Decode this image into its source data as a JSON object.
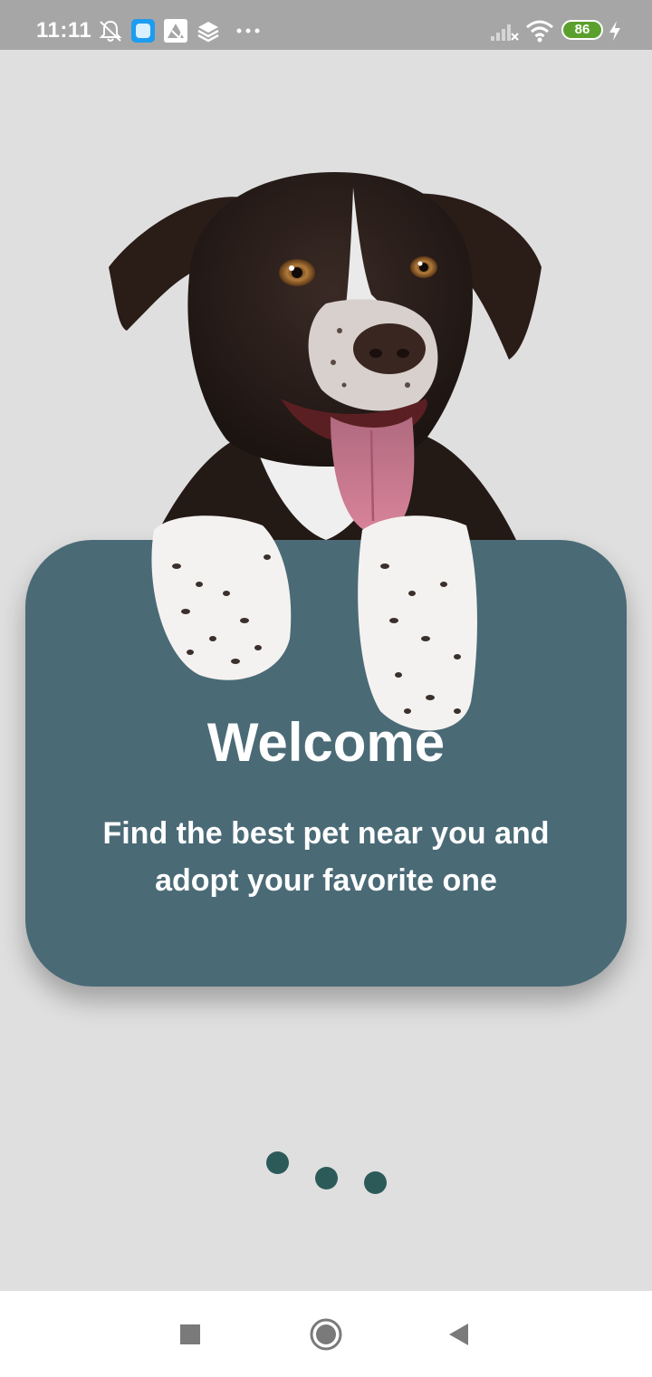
{
  "status_bar": {
    "time": "11:11",
    "battery_level": "86",
    "icons": [
      "bell-off-icon",
      "app-blue-icon",
      "app-white-icon",
      "layers-icon",
      "more-dots-icon",
      "signal-icon",
      "wifi-icon",
      "battery-icon",
      "charging-bolt-icon"
    ],
    "battery_color": "#5ba02d"
  },
  "onboarding": {
    "title": "Welcome",
    "subtitle": "Find the best pet near you and adopt your favorite one",
    "image": "dog-illustration",
    "page_indicator": {
      "pages": 3,
      "color": "#2c5a59"
    },
    "card_color": "#4a6a76"
  },
  "nav_bar": {
    "buttons": [
      "recent-apps-button",
      "home-button",
      "back-button"
    ]
  }
}
